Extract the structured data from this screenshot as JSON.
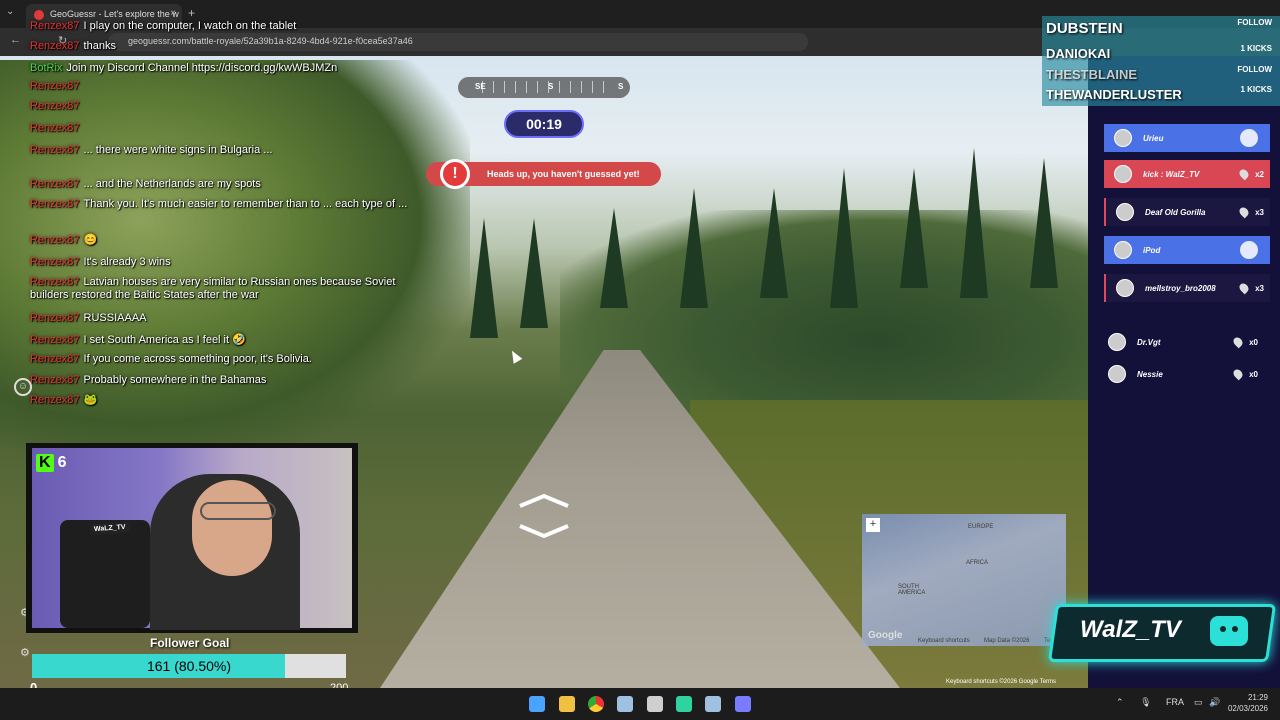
{
  "browser": {
    "tab_title": "GeoGuessr - Let's explore the w",
    "url": "geoguessr.com/battle-royale/52a39b1a-8249-4bd4-921e-f0cea5e37a46",
    "new_tab": "+",
    "tab_close": "×"
  },
  "chat": {
    "messages": [
      {
        "user": "Renzex87",
        "text": "I play on the computer, I watch on the tablet"
      },
      {
        "user": "Renzex87",
        "text": "thanks"
      },
      {
        "user": "BotRix",
        "text": "Join my Discord Channel https://discord.gg/kwWBJMZn"
      },
      {
        "user": "Renzex87",
        "text": ""
      },
      {
        "user": "Renzex87",
        "text": ""
      },
      {
        "user": "Renzex87",
        "text": ""
      },
      {
        "user": "Renzex87",
        "text": "... there were white signs in Bulgaria ..."
      },
      {
        "user": "Renzex87",
        "text": "... and the Netherlands are my spots"
      },
      {
        "user": "Renzex87",
        "text": "Thank you. It's much easier to remember than to ... each type of ..."
      },
      {
        "user": "Renzex87",
        "text": "😊"
      },
      {
        "user": "Renzex87",
        "text": "It's already 3 wins"
      },
      {
        "user": "Renzex87",
        "text": "Latvian houses are very similar to Russian ones because Soviet builders restored the Baltic States after the war"
      },
      {
        "user": "Renzex87",
        "text": "RUSSIAAAA"
      },
      {
        "user": "Renzex87",
        "text": "I set South America as I feel it 🤣"
      },
      {
        "user": "Renzex87",
        "text": "If you come across something poor, it's Bolivia."
      },
      {
        "user": "Renzex87",
        "text": "Probably somewhere in the Bahamas"
      },
      {
        "user": "Renzex87",
        "text": "🐸"
      }
    ]
  },
  "game": {
    "compass": {
      "left": "SE",
      "center": "S",
      "right": "S"
    },
    "timer": "00:19",
    "alert": "Heads up, you haven't guessed yet!",
    "alert_icon": "!"
  },
  "minimap": {
    "labels": [
      "EUROPE",
      "AFRICA",
      "SOUTH AMERICA"
    ],
    "zoom": "+",
    "google": "Google",
    "footer": [
      "Keyboard shortcuts",
      "Map Data ©2026",
      "Terms"
    ]
  },
  "streetview": {
    "credits": "Keyboard shortcuts  ©2026 Google  Terms"
  },
  "webcam": {
    "kick_count": "6",
    "kick_letter": "K",
    "shirt_tag": "WaLZ_TV"
  },
  "follower_goal": {
    "title": "Follower Goal",
    "progress_text": "161 (80.50%)",
    "progress_fraction": 0.805,
    "min": "0",
    "max": "200"
  },
  "brand": {
    "name": "WalZ_TV",
    "accent": "#2ce0d8"
  },
  "alerts": [
    {
      "name": "DUBSTEIN",
      "action": "FOLLOW"
    },
    {
      "name": "DANIOKAI",
      "action": "1 KICKS"
    },
    {
      "name": "THESTBLAINE",
      "action": "FOLLOW"
    },
    {
      "name": "THEWANDERLUSTER",
      "action": "1 KICKS"
    }
  ],
  "leaderboard": [
    {
      "name": "Urieu",
      "count": "",
      "style": "blue"
    },
    {
      "name": "kick : WalZ_TV",
      "count": "x2",
      "style": "red"
    },
    {
      "name": "Deaf Old Gorilla",
      "count": "x3",
      "style": "dark"
    },
    {
      "name": "iPod",
      "count": "",
      "style": "blue"
    },
    {
      "name": "mellstroy_bro2008",
      "count": "x3",
      "style": "dark"
    },
    {
      "name": "Dr.Vgt",
      "count": "x0",
      "style": "plain"
    },
    {
      "name": "Nessie",
      "count": "x0",
      "style": "plain"
    }
  ],
  "taskbar": {
    "lang": "FRA",
    "time": "21:29",
    "date": "02/03/2026",
    "icons": [
      "windows-start-icon",
      "file-explorer-icon",
      "chrome-icon",
      "steam-icon",
      "settings-icon",
      "app-icon",
      "steam-icon",
      "discord-icon"
    ]
  }
}
